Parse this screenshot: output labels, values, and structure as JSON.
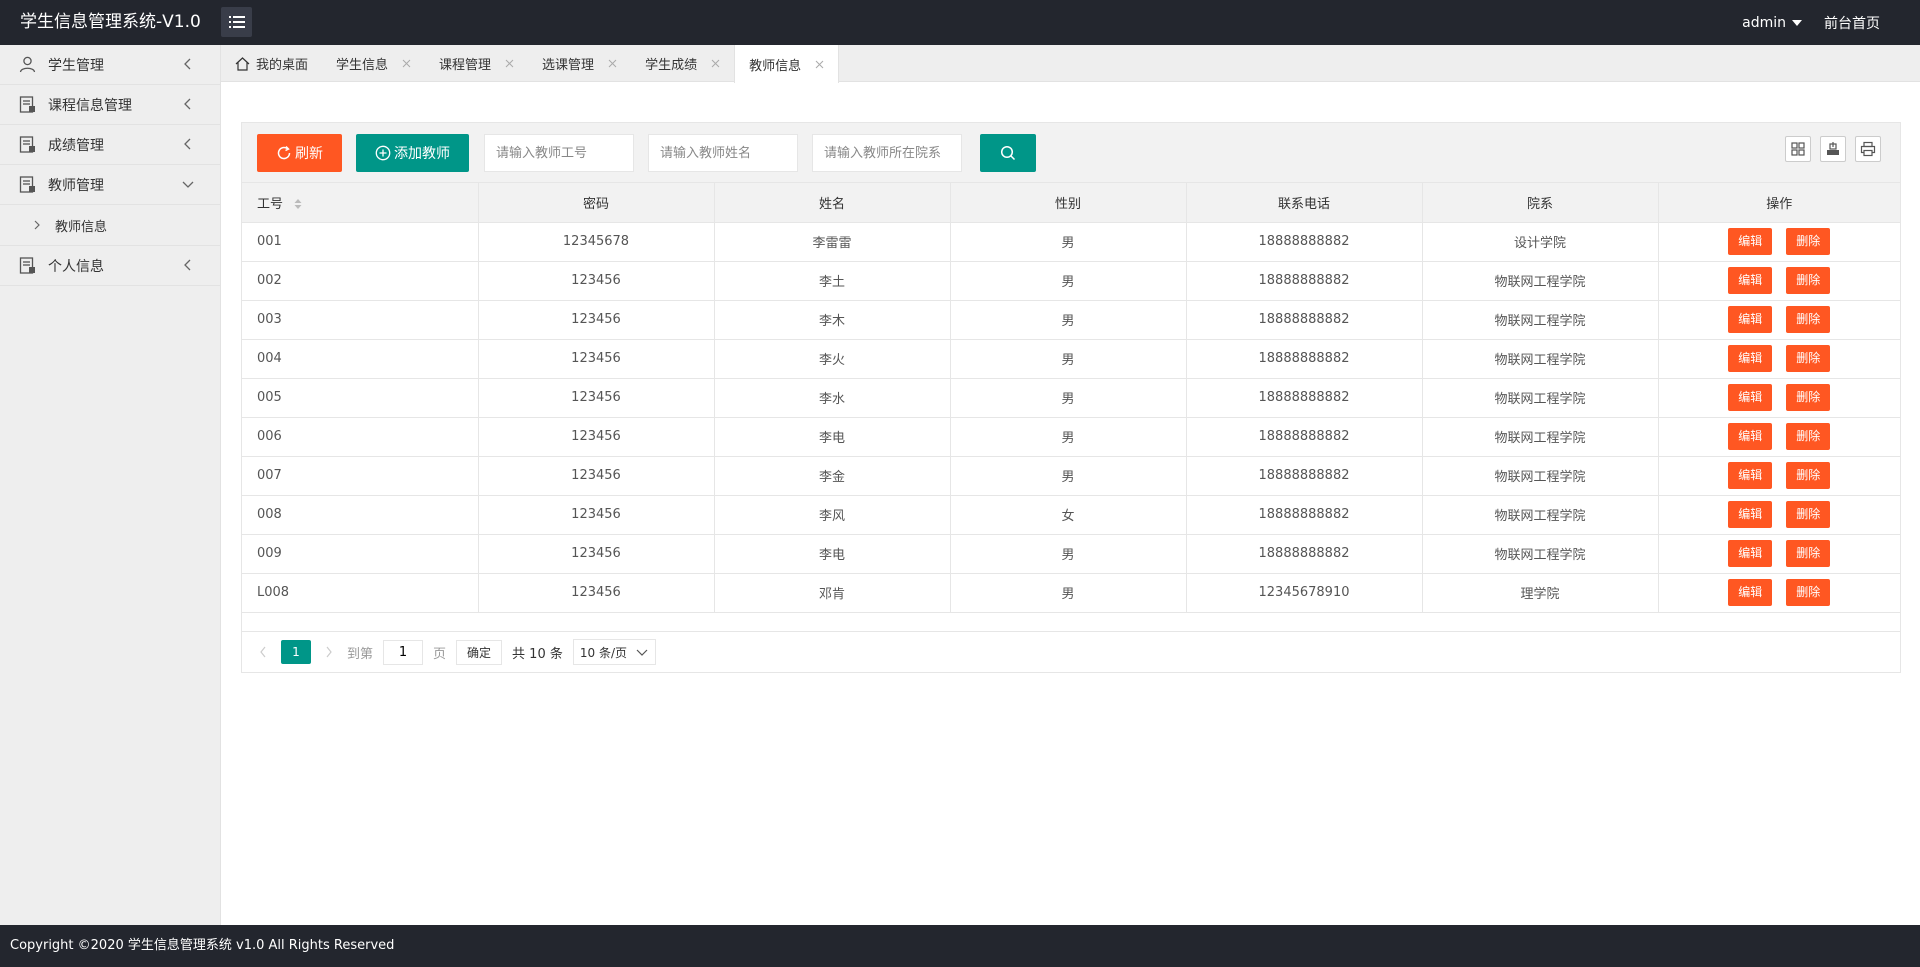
{
  "header": {
    "title": "学生信息管理系统-V1.0",
    "user": "admin",
    "home_link": "前台首页"
  },
  "sidebar": {
    "items": [
      {
        "label": "学生管理",
        "icon": "user-icon"
      },
      {
        "label": "课程信息管理",
        "icon": "document-icon"
      },
      {
        "label": "成绩管理",
        "icon": "document-icon"
      },
      {
        "label": "教师管理",
        "icon": "document-icon",
        "expanded": true
      },
      {
        "label": "个人信息",
        "icon": "document-icon"
      }
    ],
    "sub_items": [
      {
        "label": "教师信息"
      }
    ]
  },
  "tabs": [
    {
      "label": "我的桌面",
      "icon": "home-icon"
    },
    {
      "label": "学生信息"
    },
    {
      "label": "课程管理"
    },
    {
      "label": "选课管理"
    },
    {
      "label": "学生成绩"
    },
    {
      "label": "教师信息",
      "active": true
    }
  ],
  "toolbar": {
    "refresh_label": "刷新",
    "add_label": "添加教师",
    "search_id_placeholder": "请输入教师工号",
    "search_name_placeholder": "请输入教师姓名",
    "search_dept_placeholder": "请输入教师所在院系"
  },
  "table": {
    "columns": [
      "工号",
      "密码",
      "姓名",
      "性别",
      "联系电话",
      "院系",
      "操作"
    ],
    "edit_label": "编辑",
    "delete_label": "删除",
    "rows": [
      [
        "001",
        "12345678",
        "李雷雷",
        "男",
        "18888888882",
        "设计学院"
      ],
      [
        "002",
        "123456",
        "李土",
        "男",
        "18888888882",
        "物联网工程学院"
      ],
      [
        "003",
        "123456",
        "李木",
        "男",
        "18888888882",
        "物联网工程学院"
      ],
      [
        "004",
        "123456",
        "李火",
        "男",
        "18888888882",
        "物联网工程学院"
      ],
      [
        "005",
        "123456",
        "李水",
        "男",
        "18888888882",
        "物联网工程学院"
      ],
      [
        "006",
        "123456",
        "李电",
        "男",
        "18888888882",
        "物联网工程学院"
      ],
      [
        "007",
        "123456",
        "李金",
        "男",
        "18888888882",
        "物联网工程学院"
      ],
      [
        "008",
        "123456",
        "李风",
        "女",
        "18888888882",
        "物联网工程学院"
      ],
      [
        "009",
        "123456",
        "李电",
        "男",
        "18888888882",
        "物联网工程学院"
      ],
      [
        "L008",
        "123456",
        "邓肯",
        "男",
        "12345678910",
        "理学院"
      ]
    ]
  },
  "pager": {
    "current": "1",
    "goto_label": "到第",
    "goto_value": "1",
    "page_label": "页",
    "confirm_label": "确定",
    "total": "共 10 条",
    "page_size": "10 条/页"
  },
  "footer": {
    "text": "Copyright ©2020 学生信息管理系统 v1.0 All Rights Reserved"
  },
  "colors": {
    "header_bg": "#23262e",
    "accent_orange": "#ff5722",
    "accent_teal": "#009688"
  }
}
